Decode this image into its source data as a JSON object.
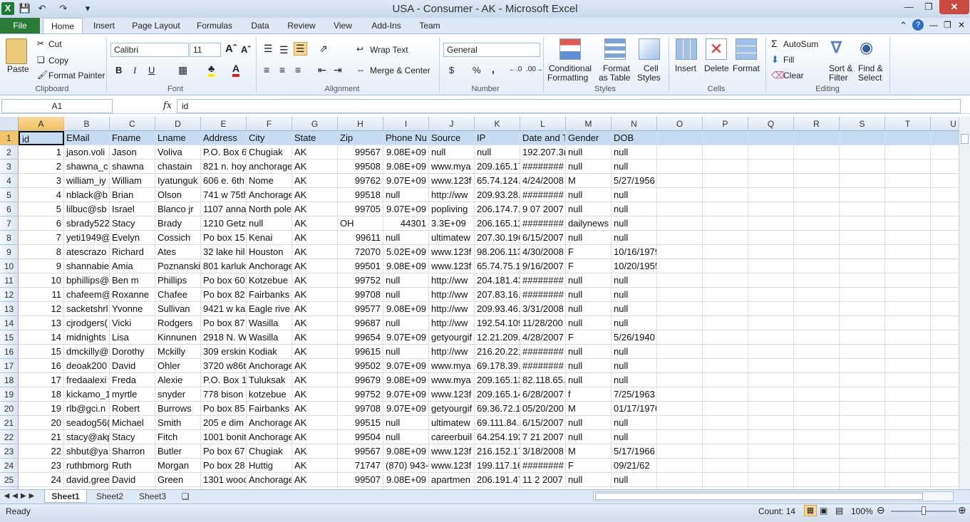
{
  "window": {
    "title": "USA - Consumer - AK  -  Microsoft Excel"
  },
  "tabs": [
    "File",
    "Home",
    "Insert",
    "Page Layout",
    "Formulas",
    "Data",
    "Review",
    "View",
    "Add-Ins",
    "Team"
  ],
  "ribbon": {
    "clipboard": {
      "paste": "Paste",
      "cut": "Cut",
      "copy": "Copy",
      "format_painter": "Format Painter",
      "label": "Clipboard"
    },
    "font": {
      "name": "Calibri",
      "size": "11",
      "label": "Font",
      "bold": "B",
      "italic": "I",
      "underline": "U"
    },
    "alignment": {
      "wrap_text": "Wrap Text",
      "merge_center": "Merge & Center",
      "label": "Alignment"
    },
    "number": {
      "format": "General",
      "currency": "$",
      "percent": "%",
      "comma": ",",
      "label": "Number"
    },
    "styles": {
      "conditional": "Conditional",
      "conditional2": "Formatting",
      "format_table": "Format",
      "format_table2": "as Table",
      "cell_styles": "Cell",
      "cell_styles2": "Styles",
      "label": "Styles"
    },
    "cells": {
      "insert": "Insert",
      "delete": "Delete",
      "format": "Format",
      "label": "Cells"
    },
    "editing": {
      "autosum": "AutoSum",
      "fill": "Fill",
      "clear": "Clear",
      "sort": "Sort &",
      "sort2": "Filter",
      "find": "Find &",
      "find2": "Select",
      "label": "Editing"
    }
  },
  "formula_bar": {
    "name_box": "A1",
    "fx": "fx",
    "content": "id"
  },
  "columns": [
    "A",
    "B",
    "C",
    "D",
    "E",
    "F",
    "G",
    "H",
    "I",
    "J",
    "K",
    "L",
    "M",
    "N",
    "O",
    "P",
    "Q",
    "R",
    "S",
    "T",
    "U"
  ],
  "rows": [
    [
      "id",
      "EMail",
      "Fname",
      "Lname",
      "Address",
      "City",
      "State",
      "Zip",
      "Phone Nu",
      "Source",
      "IP",
      "Date and T",
      "Gender",
      "DOB"
    ],
    [
      "1",
      "jason.voli",
      "Jason",
      "Voliva",
      "P.O. Box 6",
      "Chugiak",
      "AK",
      "99567",
      "9.08E+09",
      "null",
      "null",
      "192.207.3(",
      "null",
      "null"
    ],
    [
      "2",
      "shawna_c",
      "shawna",
      "chastain",
      "821 n. hoy",
      "anchorage",
      "AK",
      "99508",
      "9.08E+09",
      "www.mya",
      "209.165.17",
      "########",
      "null",
      "null"
    ],
    [
      "3",
      "william_iy",
      "William",
      "Iyatunguk",
      "606 e. 6th",
      "Nome",
      "AK",
      "99762",
      "9.07E+09",
      "www.123f",
      "65.74.124.",
      "4/24/2008",
      "M",
      "5/27/1956"
    ],
    [
      "4",
      "nblack@b",
      "Brian",
      "Olson",
      "741 w 75th",
      "Anchorage",
      "AK",
      "99518",
      "null",
      "http://ww",
      "209.93.28.",
      "########",
      "null",
      "null"
    ],
    [
      "5",
      "lilbuc@sb",
      "Israel",
      "Blanco jr",
      "1107 anna",
      "North pole",
      "AK",
      "99705",
      "9.07E+09",
      "popliving",
      "206.174.7.",
      "9 07 2007 1",
      "null",
      "null"
    ],
    [
      "6",
      "sbrady522",
      "Stacy",
      "Brady",
      "1210 Getz",
      "null",
      "AK",
      "OH",
      "44301",
      "3.3E+09",
      "206.165.11",
      "########",
      "dailynews",
      "null"
    ],
    [
      "7",
      "yeti1949@",
      "Evelyn",
      "Cossich",
      "Po box 15",
      "Kenai",
      "AK",
      "99611",
      "null",
      "ultimatew",
      "207.30.196",
      "6/15/2007",
      "null",
      "null"
    ],
    [
      "8",
      "atescrazo",
      "Richard",
      "Ates",
      "32 lake hil",
      "Houston",
      "AK",
      "72070",
      "5.02E+09",
      "www.123f",
      "98.206.113",
      "4/30/2008",
      "F",
      "10/16/1979"
    ],
    [
      "9",
      "shannabie",
      "Amia",
      "Poznanski",
      "801 karluk",
      "Anchorage",
      "AK",
      "99501",
      "9.08E+09",
      "www.123f",
      "65.74.75.1",
      "9/16/2007",
      "F",
      "10/20/1955"
    ],
    [
      "10",
      "bphillips@",
      "Ben m",
      "Phillips",
      "Po box 60",
      "Kotzebue",
      "AK",
      "99752",
      "null",
      "http://ww",
      "204.181.43",
      "########",
      "null",
      "null"
    ],
    [
      "11",
      "chafeem@",
      "Roxanne",
      "Chafee",
      "Po box 82",
      "Fairbanks",
      "AK",
      "99708",
      "null",
      "http://ww",
      "207.83.16.",
      "########",
      "null",
      "null"
    ],
    [
      "12",
      "sacketshrl",
      "Yvonne",
      "Sullivan",
      "9421 w ka",
      "Eagle rive",
      "AK",
      "99577",
      "9.08E+09",
      "http://ww",
      "209.93.46.",
      "3/31/2008",
      "null",
      "null"
    ],
    [
      "13",
      "cjrodgers(",
      "Vicki",
      "Rodgers",
      "Po box 87",
      "Wasilla",
      "AK",
      "99687",
      "null",
      "http://ww",
      "192.54.109",
      "11/28/200",
      "null",
      "null"
    ],
    [
      "14",
      "midnights",
      "Lisa",
      "Kinnunen",
      "2918 N. W",
      "Wasilla",
      "AK",
      "99654",
      "9.07E+09",
      "getyourgif",
      "12.21.209.",
      "4/28/2007",
      "F",
      "5/26/1940"
    ],
    [
      "15",
      "dmckilly@",
      "Dorothy",
      "Mckilly",
      "309 erskin",
      "Kodiak",
      "AK",
      "99615",
      "null",
      "http://ww",
      "216.20.221",
      "########",
      "null",
      "null"
    ],
    [
      "16",
      "deoak200",
      "David",
      "Ohler",
      "3720 w86t",
      "Anchorage",
      "AK",
      "99502",
      "9.07E+09",
      "www.mya",
      "69.178.39.",
      "########",
      "null",
      "null"
    ],
    [
      "17",
      "fredaalexi",
      "Freda",
      "Alexie",
      "P.O. Box 1",
      "Tuluksak",
      "AK",
      "99679",
      "9.08E+09",
      "www.mya",
      "209.165.13",
      "82.118.65.",
      "null",
      "null"
    ],
    [
      "18",
      "kickamo_1",
      "myrtle",
      "snyder",
      "778 bison",
      "kotzebue",
      "AK",
      "99752",
      "9.07E+09",
      "www.123f",
      "209.165.14",
      "6/28/2007",
      "f",
      "7/25/1963"
    ],
    [
      "19",
      "rlb@gci.n",
      "Robert",
      "Burrows",
      "Po box 85",
      "Fairbanks",
      "AK",
      "99708",
      "9.07E+09",
      "getyourgif",
      "69.36.72.1",
      "05/20/200",
      "M",
      "01/17/1976"
    ],
    [
      "20",
      "seadog56(",
      "Michael",
      "Smith",
      "205 e dim",
      "Anchorage",
      "AK",
      "99515",
      "null",
      "ultimatew",
      "69.111.84.",
      "6/15/2007",
      "null",
      "null"
    ],
    [
      "21",
      "stacy@akp",
      "Stacy",
      "Fitch",
      "1001 bonit",
      "Anchorage",
      "AK",
      "99504",
      "null",
      "careerbuil",
      "64.254.192",
      "7 21 2007 2",
      "null",
      "null"
    ],
    [
      "22",
      "shbut@ya",
      "Sharron",
      "Butler",
      "Po box 67",
      "Chugiak",
      "AK",
      "99567",
      "9.08E+09",
      "www.123f",
      "216.152.17",
      "3/18/2008",
      "M",
      "5/17/1966"
    ],
    [
      "23",
      "ruthbmorg",
      "Ruth",
      "Morgan",
      "Po box 28",
      "Huttig",
      "AK",
      "71747",
      "(870) 943-",
      "www.123f",
      "199.117.16",
      "########",
      "F",
      "09/21/62"
    ],
    [
      "24",
      "david.gree",
      "David",
      "Green",
      "1301 wooc",
      "Anchorage",
      "AK",
      "99507",
      "9.08E+09",
      "apartmen",
      "206.191.47",
      "11 2 2007 (",
      "null",
      "null"
    ]
  ],
  "sheets": [
    "Sheet1",
    "Sheet2",
    "Sheet3"
  ],
  "status": {
    "ready": "Ready",
    "count": "Count: 14",
    "zoom": "100%"
  }
}
